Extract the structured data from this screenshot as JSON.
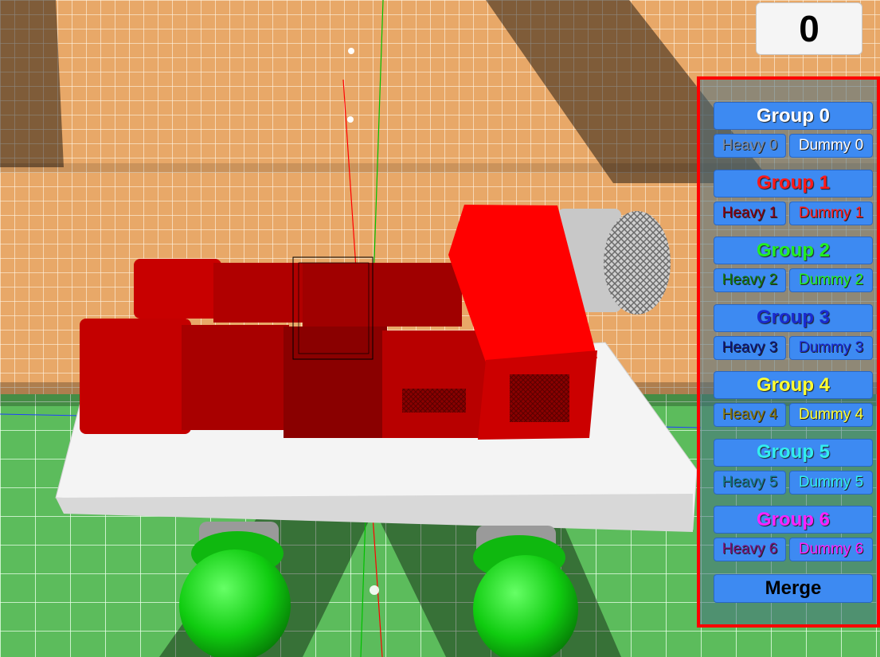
{
  "score": "0",
  "groups": [
    {
      "label": "Group 0",
      "heavy": "Heavy 0",
      "dummy": "Dummy 0",
      "title_color": "#ffffff",
      "heavy_color": "#7a8aa0",
      "dummy_color": "#ffffff"
    },
    {
      "label": "Group 1",
      "heavy": "Heavy 1",
      "dummy": "Dummy 1",
      "title_color": "#ff1a1a",
      "heavy_color": "#8a0010",
      "dummy_color": "#ff1a1a"
    },
    {
      "label": "Group 2",
      "heavy": "Heavy 2",
      "dummy": "Dummy 2",
      "title_color": "#22ee22",
      "heavy_color": "#127a12",
      "dummy_color": "#22ee22"
    },
    {
      "label": "Group 3",
      "heavy": "Heavy 3",
      "dummy": "Dummy 3",
      "title_color": "#1a2ad0",
      "heavy_color": "#0a157a",
      "dummy_color": "#1a2ad0"
    },
    {
      "label": "Group 4",
      "heavy": "Heavy 4",
      "dummy": "Dummy 4",
      "title_color": "#ffff33",
      "heavy_color": "#8a7a10",
      "dummy_color": "#ffff33"
    },
    {
      "label": "Group 5",
      "heavy": "Heavy 5",
      "dummy": "Dummy 5",
      "title_color": "#33eeee",
      "heavy_color": "#127a8a",
      "dummy_color": "#33eeee"
    },
    {
      "label": "Group 6",
      "heavy": "Heavy 6",
      "dummy": "Dummy 6",
      "title_color": "#ff22ff",
      "heavy_color": "#7a127a",
      "dummy_color": "#ff22ff"
    }
  ],
  "merge_label": "Merge",
  "colors": {
    "panel_border": "#ff0000",
    "button_blue": "#3d8af2",
    "wall_orange": "#e8a868",
    "floor_green": "#5cbc5c",
    "vehicle_red": "#d80000"
  }
}
